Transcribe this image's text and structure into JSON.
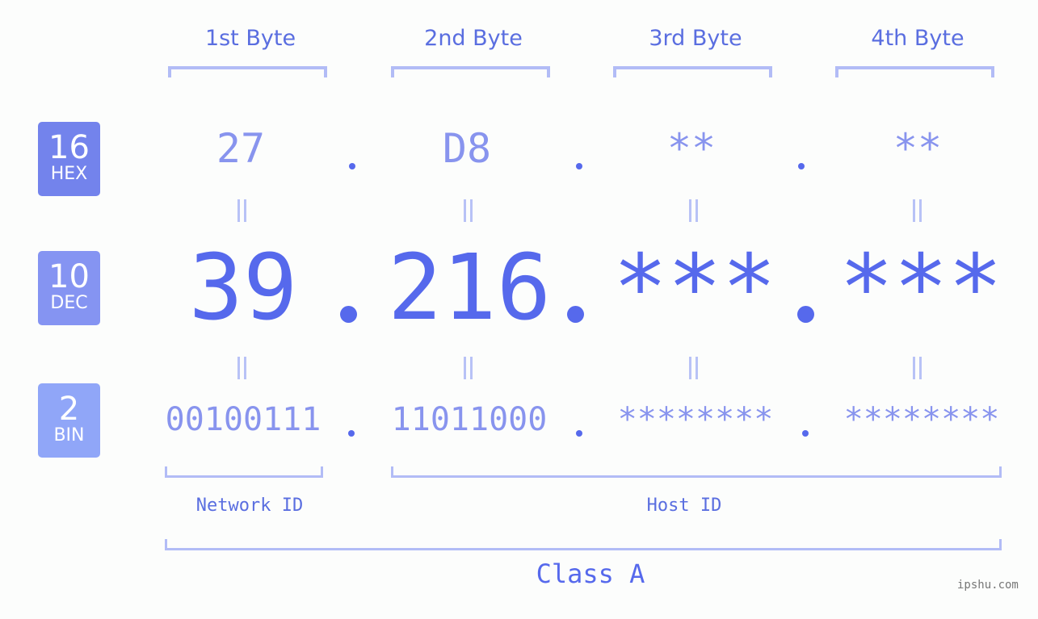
{
  "bytes": [
    {
      "label": "1st Byte",
      "hex": "27",
      "dec": "39",
      "bin": "00100111"
    },
    {
      "label": "2nd Byte",
      "hex": "D8",
      "dec": "216",
      "bin": "11011000"
    },
    {
      "label": "3rd Byte",
      "hex": "**",
      "dec": "***",
      "bin": "********"
    },
    {
      "label": "4th Byte",
      "hex": "**",
      "dec": "***",
      "bin": "********"
    }
  ],
  "badges": {
    "hex": {
      "num": "16",
      "label": "HEX",
      "color": "#7383ec"
    },
    "dec": {
      "num": "10",
      "label": "DEC",
      "color": "#8594f2"
    },
    "bin": {
      "num": "2",
      "label": "BIN",
      "color": "#90a6f8"
    }
  },
  "segments": {
    "network": "Network ID",
    "host": "Host ID",
    "class": "Class A"
  },
  "watermark": "ipshu.com"
}
